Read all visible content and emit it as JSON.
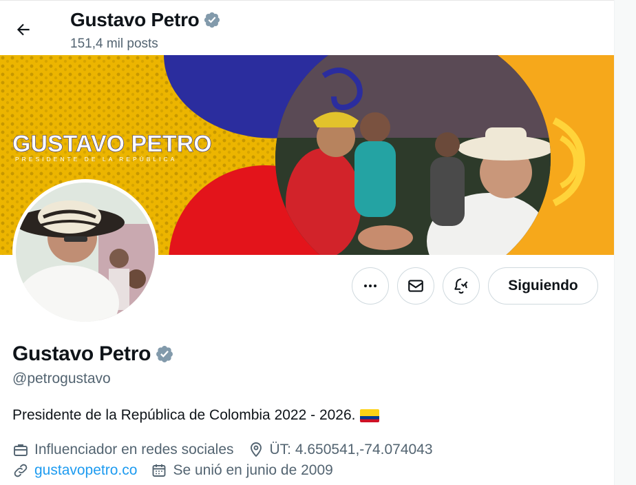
{
  "header": {
    "title": "Gustavo Petro",
    "posts_count": "151,4 mil posts"
  },
  "banner": {
    "title_text": "GUSTAVO PETRO",
    "subtitle_text": "PRESIDENTE DE LA REPÚBLICA",
    "colors": {
      "yellow": "#f2b400",
      "blue": "#2b2d9e",
      "red": "#e3141b",
      "orange": "#f6a81b"
    }
  },
  "actions": {
    "more_icon": "more-horizontal-icon",
    "message_icon": "envelope-icon",
    "notify_icon": "bell-check-icon",
    "follow_label": "Siguiendo"
  },
  "profile": {
    "name": "Gustavo Petro",
    "handle": "@petrogustavo",
    "bio": "Presidente de la República de Colombia 2022 - 2026.",
    "category": "Influenciador en redes sociales",
    "location": "ÜT: 4.650541,-74.074043",
    "website": "gustavopetro.co",
    "joined": "Se unió en junio de 2009",
    "verified_color": "#829aab"
  }
}
